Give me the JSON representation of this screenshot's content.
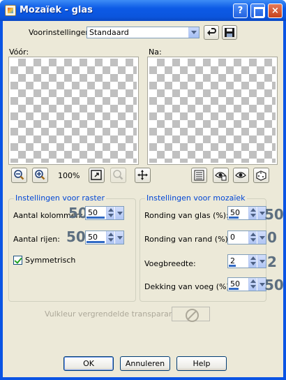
{
  "window": {
    "title": "Mozaïek - glas",
    "help_glyph": "?",
    "close_glyph": "×"
  },
  "presets": {
    "label": "Voorinstellingen:",
    "value": "Standaard",
    "icons": [
      "reset-icon",
      "save-icon"
    ]
  },
  "preview": {
    "before_label": "Vóór:",
    "after_label": "Na:"
  },
  "toolbar": {
    "zoom": "100%",
    "left_icons": [
      "zoom-out-icon",
      "zoom-in-icon",
      "fit-window-icon",
      "zoom-reset-icon",
      "pan-icon"
    ],
    "right_icons": [
      "proof-icon",
      "auto-proof-icon",
      "preview-eye-icon",
      "randomize-icon"
    ]
  },
  "grid_group": {
    "title": "Instellingen voor raster",
    "columns_label": "Aantal kolommen:",
    "columns_value": "50",
    "rows_label": "Aantal rijen:",
    "rows_value": "50",
    "symmetric_label": "Symmetrisch",
    "symmetric_checked": true
  },
  "mosaic_group": {
    "title": "Instellingen voor mozaïek",
    "glass_rounding_label": "Ronding van glas (%):",
    "glass_rounding_value": "50",
    "edge_rounding_label": "Ronding van rand (%):",
    "edge_rounding_value": "0",
    "grout_width_label": "Voegbreedte:",
    "grout_width_value": "2",
    "grout_opacity_label": "Dekking van voeg (%):",
    "grout_opacity_value": "50"
  },
  "annotations": {
    "columns": "50",
    "rows": "50",
    "glass_rounding": "50",
    "edge_rounding": "0",
    "grout_width": "2",
    "grout_opacity": "50"
  },
  "fill_color": {
    "label": "Vulkleur vergrendelde transparantie:",
    "icon": "no-color-icon"
  },
  "buttons": {
    "ok": "OK",
    "cancel": "Annuleren",
    "help": "Help"
  }
}
